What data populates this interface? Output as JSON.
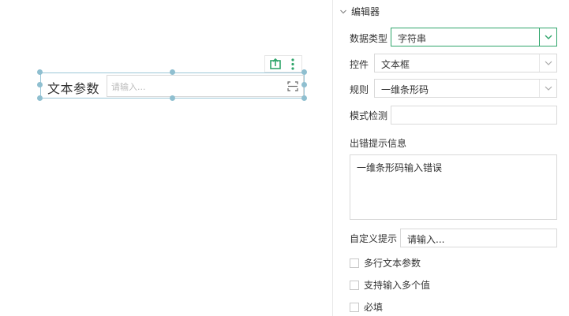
{
  "canvas": {
    "widget": {
      "label": "文本参数",
      "input_placeholder": "请输入...",
      "icons": [
        "scan-icon",
        "export-icon",
        "more-vertical-icon"
      ]
    }
  },
  "panel": {
    "section_title": "编辑器",
    "data_type": {
      "label": "数据类型",
      "value": "字符串"
    },
    "control": {
      "label": "控件",
      "value": "文本框"
    },
    "rule": {
      "label": "规则",
      "value": "一维条形码"
    },
    "pattern_check": {
      "label": "模式检测",
      "value": ""
    },
    "error_info": {
      "label": "出错提示信息",
      "value": "一维条形码输入错误"
    },
    "custom_hint": {
      "label": "自定义提示",
      "placeholder": "请输入..."
    },
    "options": [
      {
        "label": "多行文本参数",
        "checked": false
      },
      {
        "label": "支持输入多个值",
        "checked": false
      },
      {
        "label": "必填",
        "checked": false
      }
    ]
  },
  "colors": {
    "accent_green": "#2fa56b",
    "selection_blue": "#8fbfd0"
  }
}
